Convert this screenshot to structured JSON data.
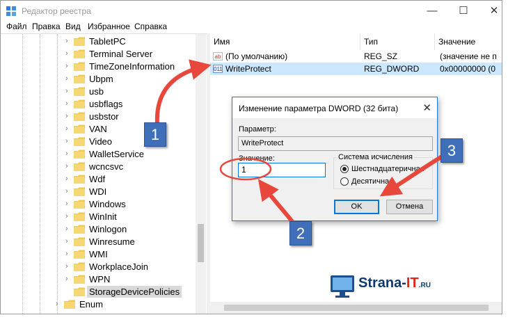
{
  "window": {
    "title": "Редактор реестра"
  },
  "menu": [
    "Файл",
    "Правка",
    "Вид",
    "Избранное",
    "Справка"
  ],
  "tree": {
    "items": [
      {
        "label": "TabletPC"
      },
      {
        "label": "Terminal Server"
      },
      {
        "label": "TimeZoneInformation"
      },
      {
        "label": "Ubpm"
      },
      {
        "label": "usb"
      },
      {
        "label": "usbflags"
      },
      {
        "label": "usbstor"
      },
      {
        "label": "VAN"
      },
      {
        "label": "Video"
      },
      {
        "label": "WalletService"
      },
      {
        "label": "wcncsvc"
      },
      {
        "label": "Wdf"
      },
      {
        "label": "WDI"
      },
      {
        "label": "Windows"
      },
      {
        "label": "WinInit"
      },
      {
        "label": "Winlogon"
      },
      {
        "label": "Winresume"
      },
      {
        "label": "WMI"
      },
      {
        "label": "WorkplaceJoin"
      },
      {
        "label": "WPN"
      },
      {
        "label": "StorageDevicePolicies"
      },
      {
        "label": "Enum"
      }
    ]
  },
  "list": {
    "columns": [
      "Имя",
      "Тип",
      "Значение"
    ],
    "rows": [
      {
        "icon": "ab",
        "name": "(По умолчанию)",
        "type": "REG_SZ",
        "value": "(значение не п"
      },
      {
        "icon": "011",
        "name": "WriteProtect",
        "type": "REG_DWORD",
        "value": "0x00000000 (0"
      }
    ]
  },
  "dialog": {
    "title": "Изменение параметра DWORD (32 бита)",
    "param_label": "Параметр:",
    "param_value": "WriteProtect",
    "value_label": "Значение:",
    "value": "1",
    "base_label": "Система исчисления",
    "hex_label": "Шестнадцатеричная",
    "dec_label": "Десятичная",
    "ok": "OK",
    "cancel": "Отмена"
  },
  "annotations": {
    "badge1": "1",
    "badge2": "2",
    "badge3": "3"
  },
  "logo": {
    "brand_main": "Strana-",
    "brand_it": "IT",
    "brand_tld": ".RU"
  },
  "colors": {
    "selection": "#cce8ff",
    "dialog_border": "#1f7bd8",
    "arrow": "#e8473c",
    "badge": "#3f6fb8"
  }
}
